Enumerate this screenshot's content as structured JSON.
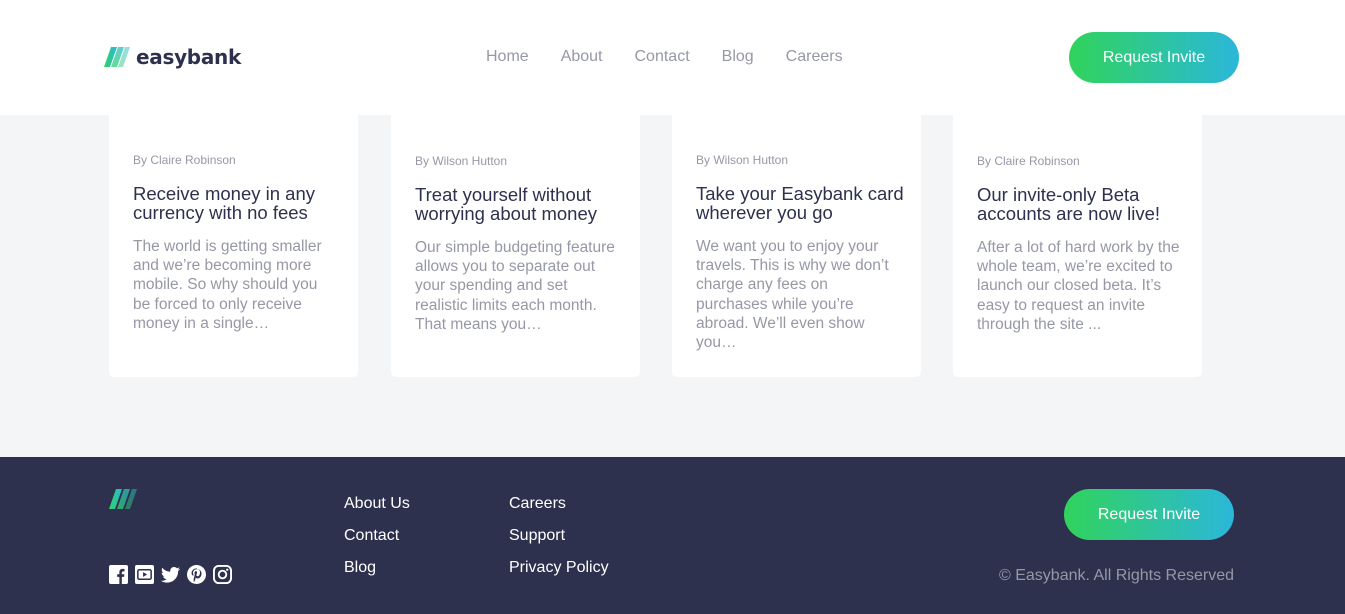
{
  "header": {
    "logo_text": "easybank",
    "nav": [
      "Home",
      "About",
      "Contact",
      "Blog",
      "Careers"
    ],
    "cta_label": "Request Invite"
  },
  "articles": [
    {
      "author": "By Claire Robinson",
      "title": "Receive money in any currency with no fees",
      "excerpt": "The world is getting smaller and we’re becoming more mobile. So why should you be forced to only receive money in a single…"
    },
    {
      "author": "By Wilson Hutton",
      "title": "Treat yourself without worrying about money",
      "excerpt": "Our simple budgeting feature allows you to separate out your spending and set realistic limits each month. That means you…"
    },
    {
      "author": "By Wilson Hutton",
      "title": "Take your Easybank card wherever you go",
      "excerpt": "We want you to enjoy your travels. This is why we don’t charge any fees on purchases while you’re abroad. We’ll even show you…"
    },
    {
      "author": "By Claire Robinson",
      "title": "Our invite-only Beta accounts are now live!",
      "excerpt": "After a lot of hard work by the whole team, we’re excited to launch our closed beta. It’s easy to request an invite through the site ..."
    }
  ],
  "footer": {
    "links_col1": [
      "About Us",
      "Contact",
      "Blog"
    ],
    "links_col2": [
      "Careers",
      "Support",
      "Privacy Policy"
    ],
    "socials": [
      "facebook-icon",
      "youtube-icon",
      "twitter-icon",
      "pinterest-icon",
      "instagram-icon"
    ],
    "cta_label": "Request Invite",
    "copyright": "© Easybank. All Rights Reserved"
  },
  "colors": {
    "dark_blue": "#2d314d",
    "lime_green": "#31d35c",
    "bright_cyan": "#2bb7da",
    "grayish_blue": "#9698a6",
    "light_gray": "#f4f5f7"
  }
}
